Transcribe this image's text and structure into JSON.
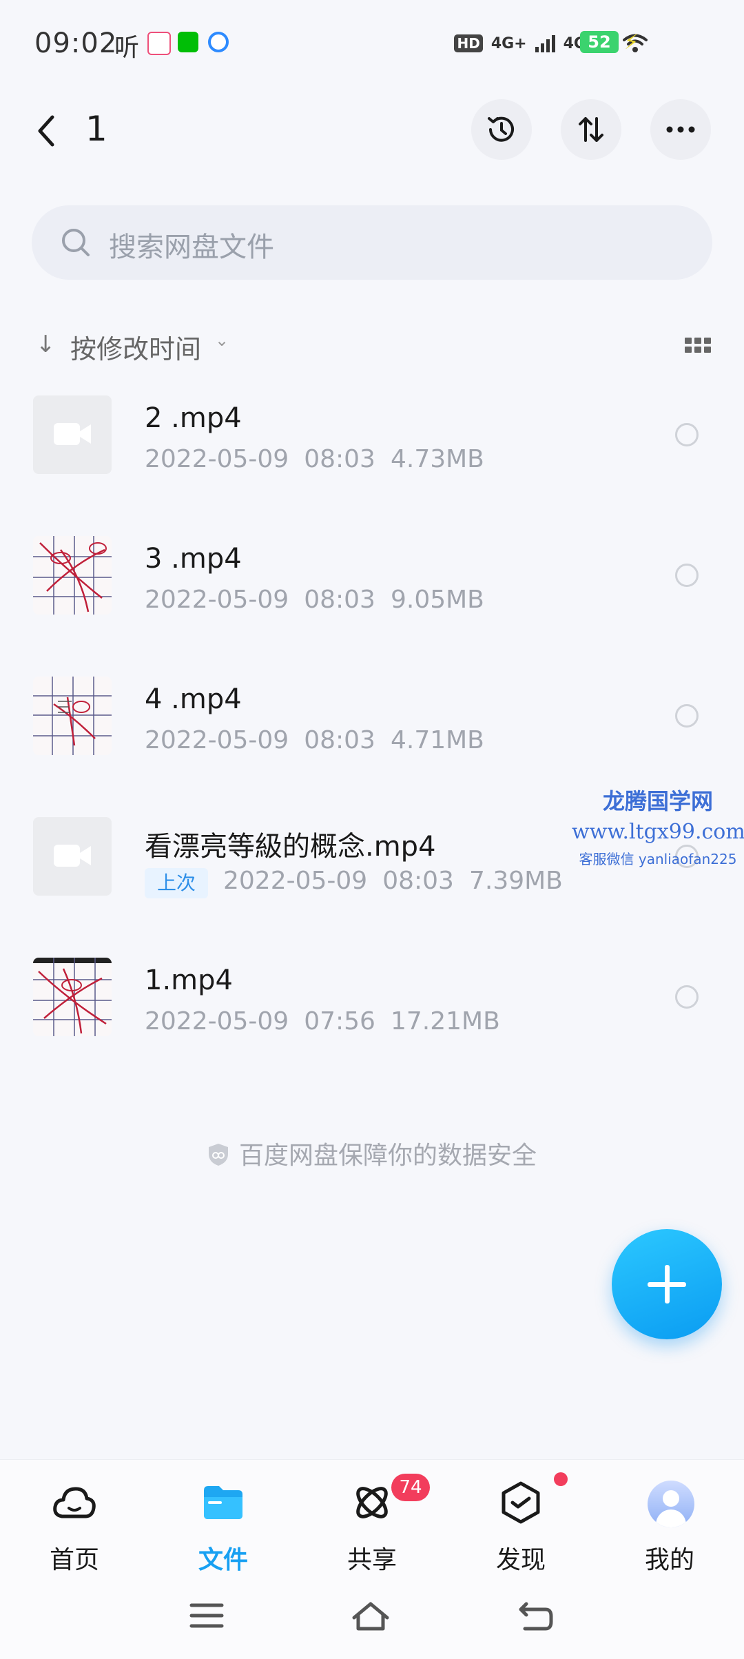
{
  "status_bar": {
    "time": "09:02",
    "ting": "听",
    "hd": "HD",
    "network1": "4G+",
    "network2": "4G",
    "battery": "52"
  },
  "header": {
    "title": "1"
  },
  "search": {
    "placeholder": "搜索网盘文件"
  },
  "sort": {
    "label": "按修改时间"
  },
  "files": [
    {
      "name": "2 .mp4",
      "date": "2022-05-09",
      "time": "08:03",
      "size": "4.73MB",
      "thumb": "video-placeholder"
    },
    {
      "name": "3 .mp4",
      "date": "2022-05-09",
      "time": "08:03",
      "size": "9.05MB",
      "thumb": "chart-thumbnail"
    },
    {
      "name": "4 .mp4",
      "date": "2022-05-09",
      "time": "08:03",
      "size": "4.71MB",
      "thumb": "chart-thumbnail"
    },
    {
      "name": "看漂亮等級的概念.mp4",
      "tag": "上次",
      "date": "2022-05-09",
      "time": "08:03",
      "size": "7.39MB",
      "thumb": "video-placeholder"
    },
    {
      "name": "1.mp4",
      "date": "2022-05-09",
      "time": "07:56",
      "size": "17.21MB",
      "thumb": "chart-thumbnail"
    }
  ],
  "watermark": {
    "title": "龙腾国学网",
    "url": "www.ltgx99.com",
    "service": "客服微信 yanliaofan225"
  },
  "security_note": "百度网盘保障你的数据安全",
  "nav": {
    "home": "首页",
    "files": "文件",
    "share": "共享",
    "share_badge": "74",
    "discover": "发现",
    "mine": "我的"
  },
  "colors": {
    "accent": "#18a0f2",
    "badge": "#f23d5c",
    "tag_bg": "#e8f3ff"
  }
}
